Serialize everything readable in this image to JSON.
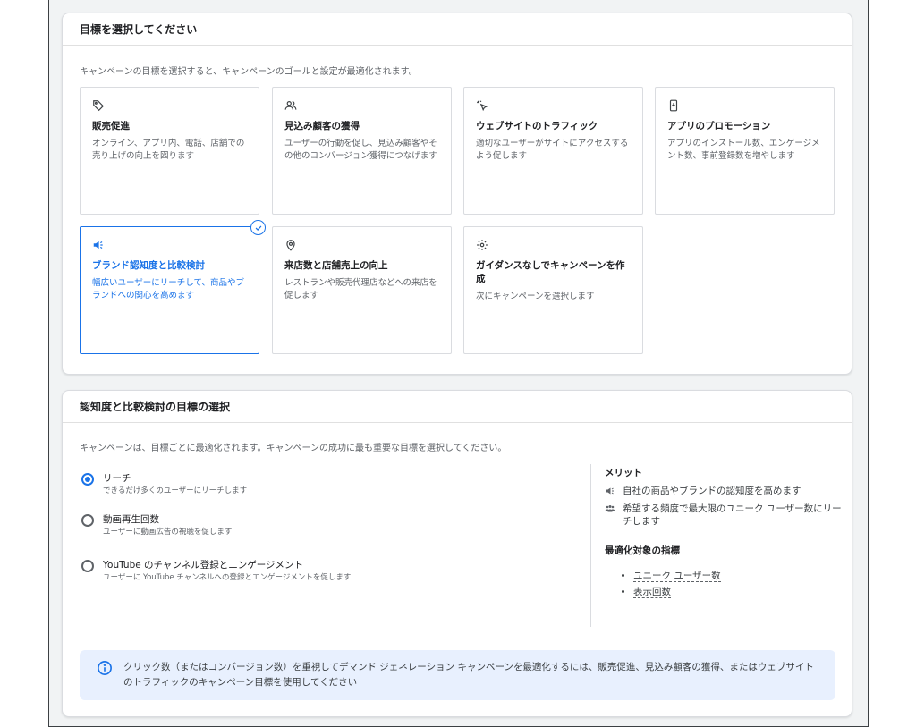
{
  "objective_section": {
    "title": "目標を選択してください",
    "description": "キャンペーンの目標を選択すると、キャンペーンのゴールと設定が最適化されます。",
    "goals": [
      {
        "icon": "tag-icon",
        "title": "販売促進",
        "description": "オンライン、アプリ内、電話、店舗での売り上げの向上を図ります",
        "selected": false
      },
      {
        "icon": "people-icon",
        "title": "見込み顧客の獲得",
        "description": "ユーザーの行動を促し、見込み顧客やその他のコンバージョン獲得につなげます",
        "selected": false
      },
      {
        "icon": "cursor-click-icon",
        "title": "ウェブサイトのトラフィック",
        "description": "適切なユーザーがサイトにアクセスするよう促します",
        "selected": false
      },
      {
        "icon": "mobile-app-icon",
        "title": "アプリのプロモーション",
        "description": "アプリのインストール数、エンゲージメント数、事前登録数を増やします",
        "selected": false
      },
      {
        "icon": "megaphone-icon",
        "title": "ブランド認知度と比較検討",
        "description": "幅広いユーザーにリーチして、商品やブランドへの関心を高めます",
        "selected": true
      },
      {
        "icon": "location-pin-icon",
        "title": "来店数と店舗売上の向上",
        "description": "レストランや販売代理店などへの来店を促します",
        "selected": false
      },
      {
        "icon": "gear-icon",
        "title": "ガイダンスなしでキャンペーンを作成",
        "description": "次にキャンペーンを選択します",
        "selected": false
      }
    ]
  },
  "subgoal_section": {
    "title": "認知度と比較検討の目標の選択",
    "description": "キャンペーンは、目標ごとに最適化されます。キャンペーンの成功に最も重要な目標を選択してください。",
    "options": [
      {
        "label": "リーチ",
        "sub": "できるだけ多くのユーザーにリーチします",
        "checked": true
      },
      {
        "label": "動画再生回数",
        "sub": "ユーザーに動画広告の視聴を促します",
        "checked": false
      },
      {
        "label": "YouTube のチャンネル登録とエンゲージメント",
        "sub": "ユーザーに YouTube チャンネルへの登録とエンゲージメントを促します",
        "checked": false
      }
    ],
    "benefits_title": "メリット",
    "benefits": [
      {
        "icon": "megaphone-icon",
        "text": "自社の商品やブランドの認知度を高めます"
      },
      {
        "icon": "group-icon",
        "text": "希望する頻度で最大限のユニーク ユーザー数にリーチします"
      }
    ],
    "metrics_title": "最適化対象の指標",
    "metrics": [
      "ユニーク ユーザー数",
      "表示回数"
    ],
    "info_text": "クリック数（またはコンバージョン数）を重視してデマンド ジェネレーション キャンペーンを最適化するには、販売促進、見込み顧客の獲得、またはウェブサイトのトラフィックのキャンペーン目標を使用してください"
  },
  "colors": {
    "accent": "#1a73e8",
    "background": "#f1f3f4",
    "info_background": "#e8f0fe"
  }
}
